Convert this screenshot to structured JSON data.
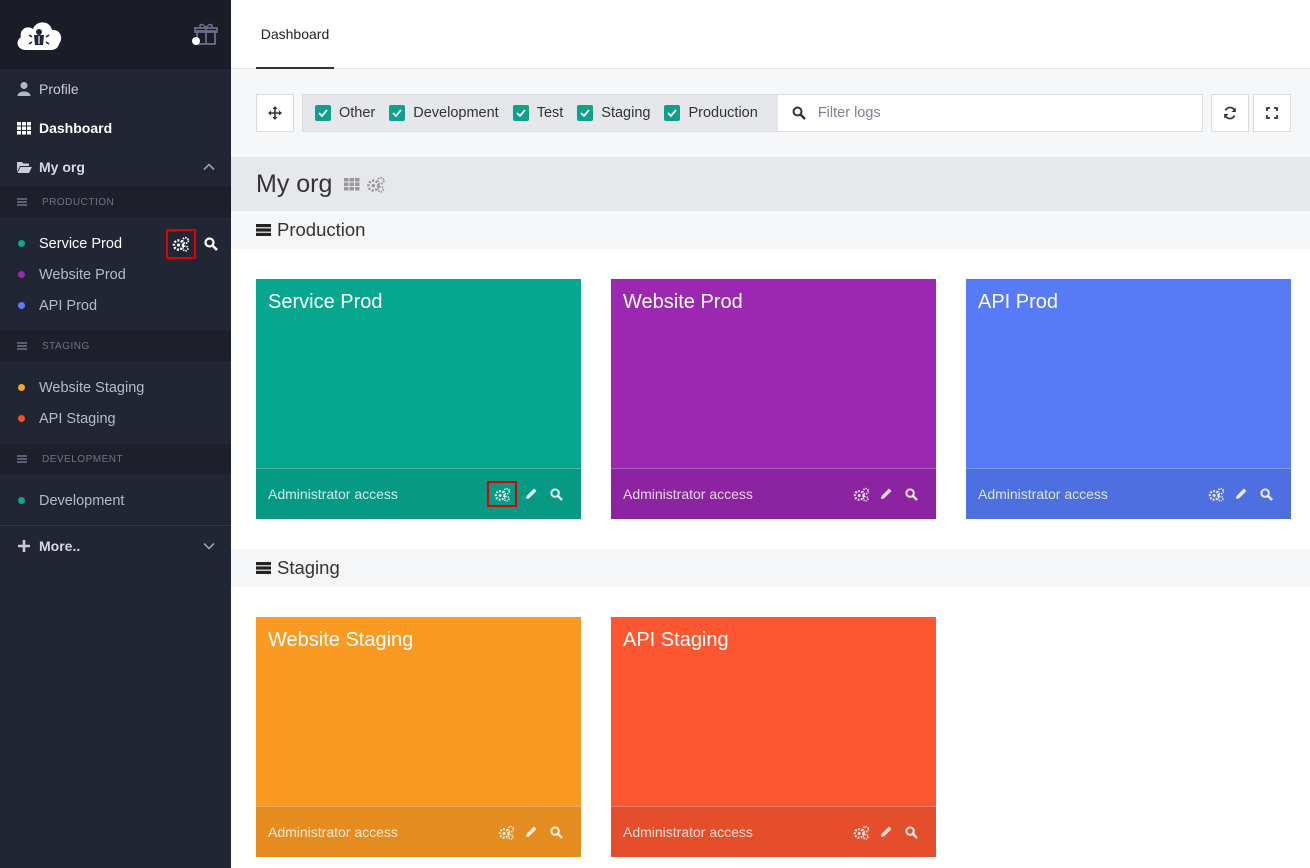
{
  "sidebar": {
    "profile": "Profile",
    "dashboard": "Dashboard",
    "org": "My org",
    "sections": [
      {
        "label": "PRODUCTION",
        "items": [
          {
            "name": "Service Prod",
            "color": "#0fa58e"
          },
          {
            "name": "Website Prod",
            "color": "#9c27b0"
          },
          {
            "name": "API Prod",
            "color": "#5b7cf7"
          }
        ]
      },
      {
        "label": "STAGING",
        "items": [
          {
            "name": "Website Staging",
            "color": "#f9a825"
          },
          {
            "name": "API Staging",
            "color": "#f4511e"
          }
        ]
      },
      {
        "label": "DEVELOPMENT",
        "items": [
          {
            "name": "Development",
            "color": "#0fa58e"
          }
        ]
      }
    ],
    "more": "More.."
  },
  "topbar": {
    "tab": "Dashboard"
  },
  "filters": {
    "checks": [
      {
        "label": "Other",
        "checked": true
      },
      {
        "label": "Development",
        "checked": true
      },
      {
        "label": "Test",
        "checked": true
      },
      {
        "label": "Staging",
        "checked": true
      },
      {
        "label": "Production",
        "checked": true
      }
    ],
    "search_placeholder": "Filter logs",
    "search_value": ""
  },
  "main": {
    "org_title": "My org",
    "groups": [
      {
        "label": "Production",
        "cards": [
          {
            "title": "Service Prod",
            "access": "Administrator access",
            "color": "#07a78f",
            "foot": "#069a84"
          },
          {
            "title": "Website Prod",
            "access": "Administrator access",
            "color": "#9c27b0",
            "foot": "#8c23a1"
          },
          {
            "title": "API Prod",
            "access": "Administrator access",
            "color": "#577bf7",
            "foot": "#4d6fe0"
          }
        ]
      },
      {
        "label": "Staging",
        "cards": [
          {
            "title": "Website Staging",
            "access": "Administrator access",
            "color": "#fa9a22",
            "foot": "#e48c1f"
          },
          {
            "title": "API Staging",
            "access": "Administrator access",
            "color": "#fd5630",
            "foot": "#e54e2b"
          }
        ]
      }
    ]
  }
}
